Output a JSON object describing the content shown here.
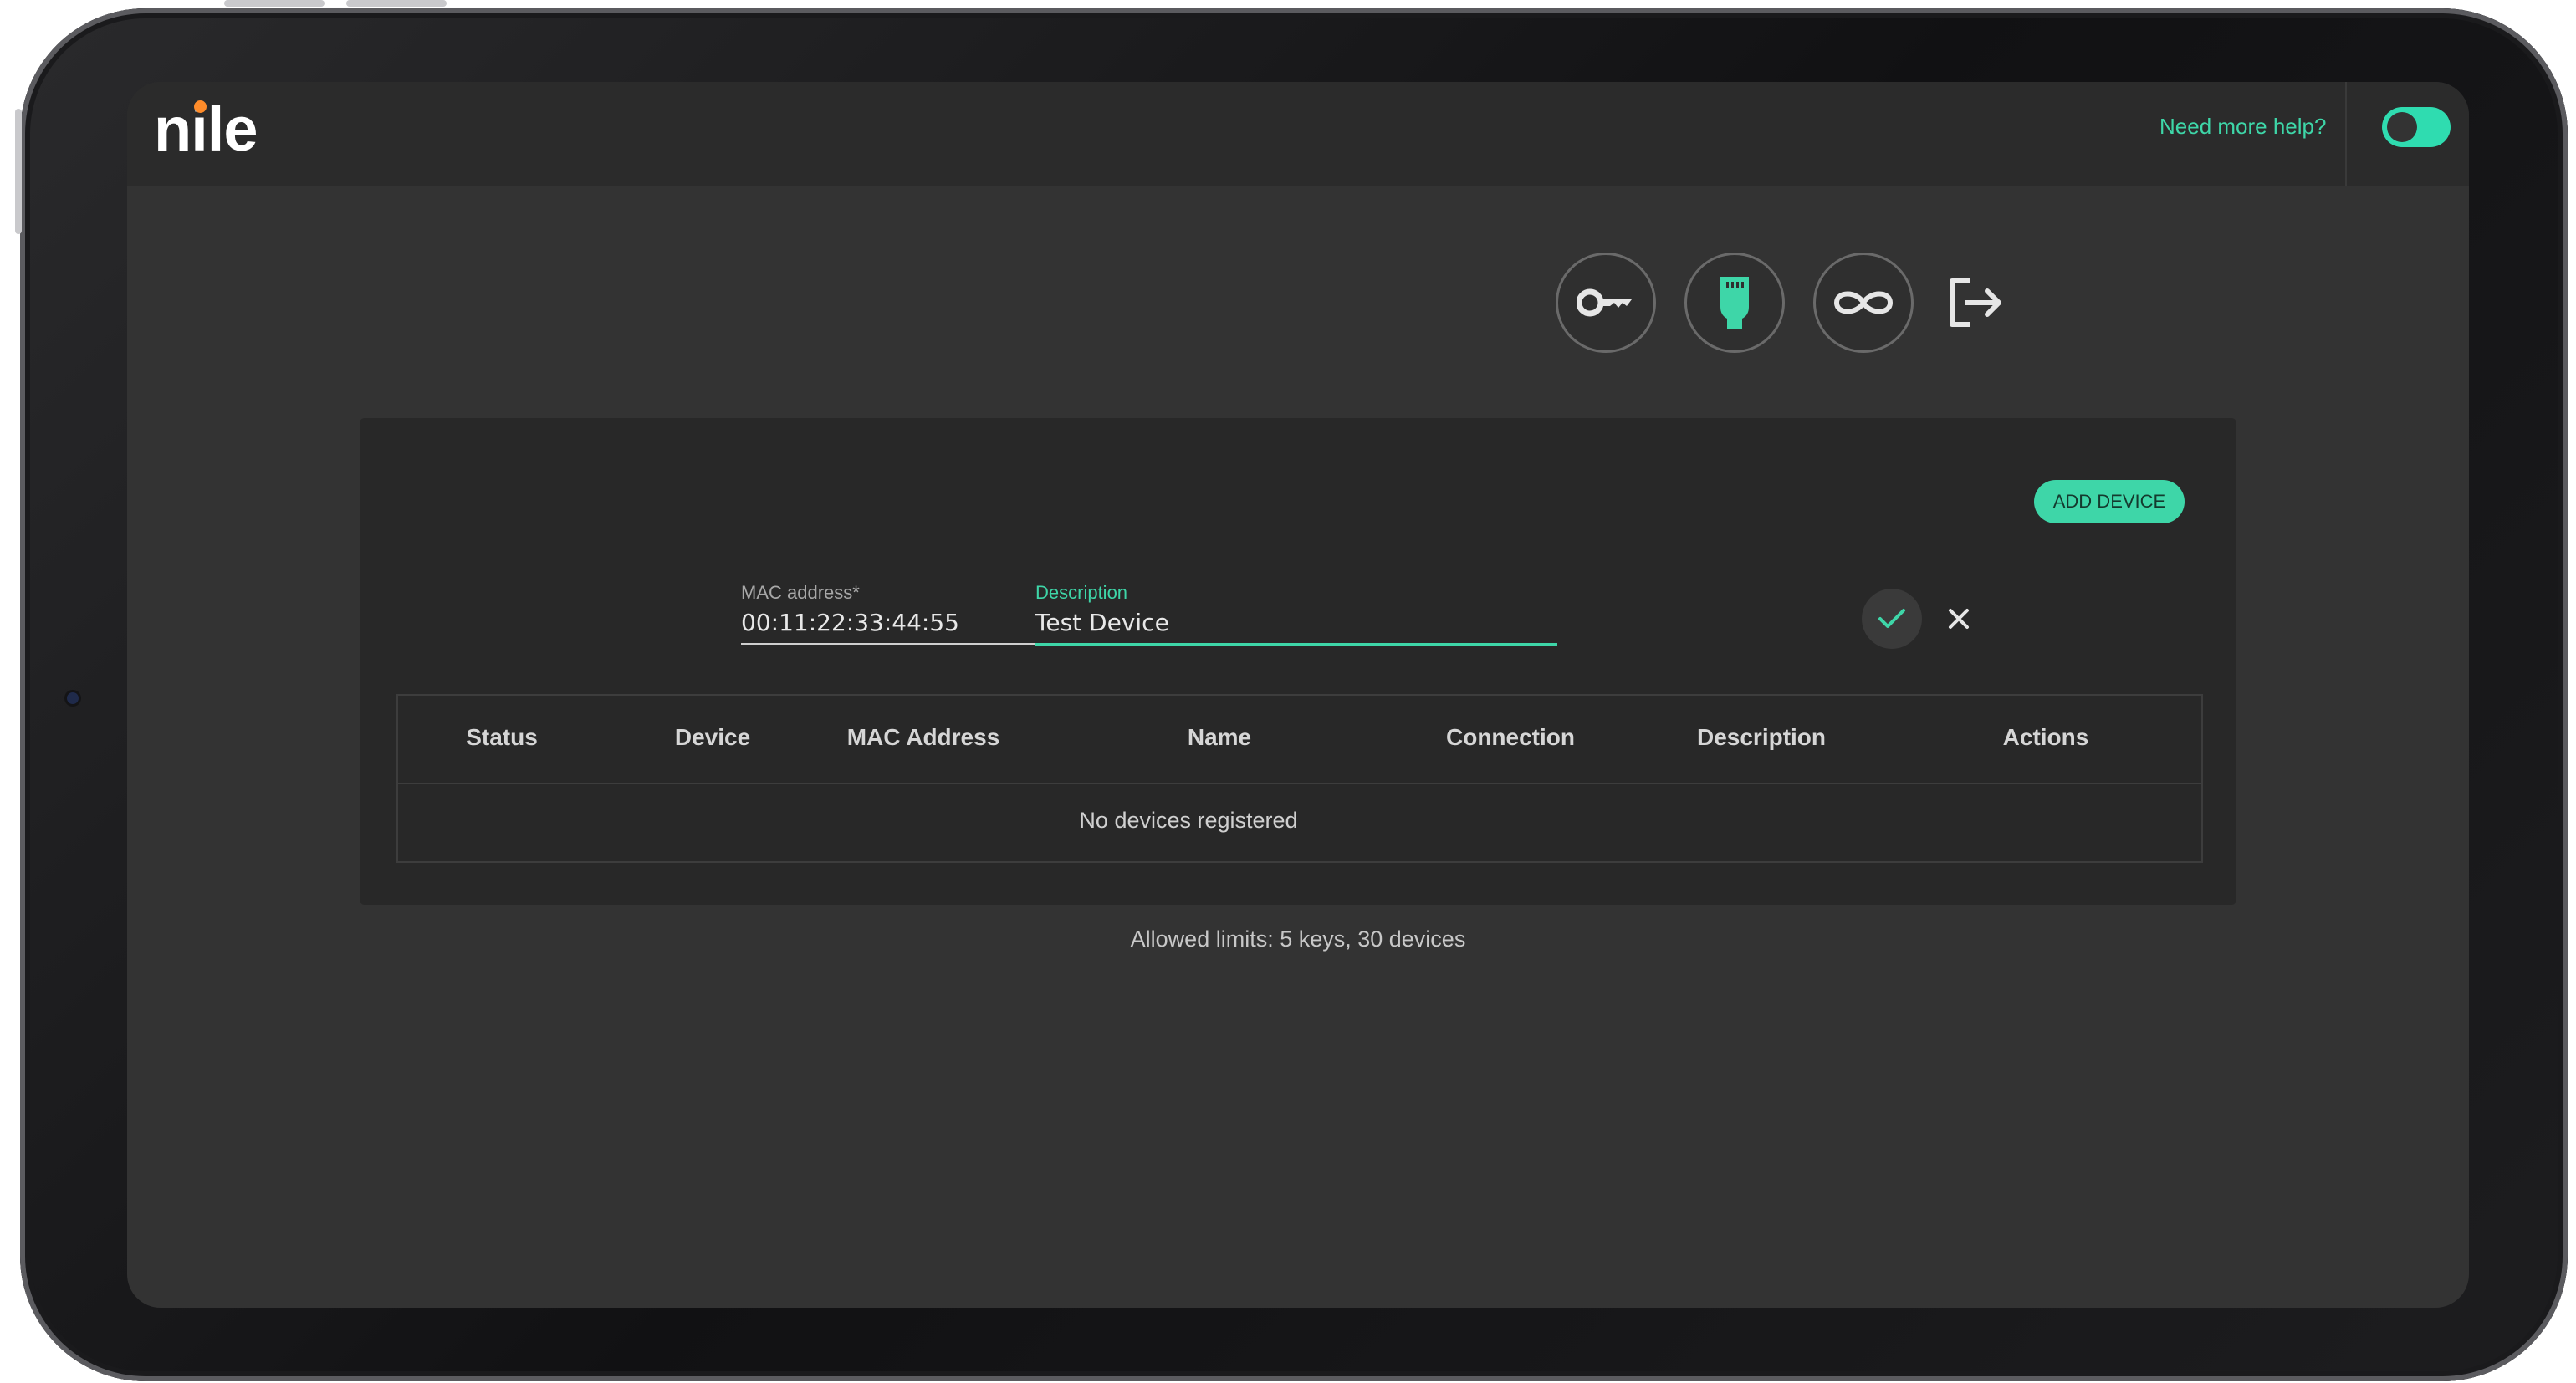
{
  "app": {
    "logo_text": "nile",
    "help_link": "Need more help?",
    "theme_toggle": {
      "state": "on"
    }
  },
  "toolbar": {
    "icons": [
      "key-icon",
      "ethernet-plug-icon",
      "infinity-link-icon",
      "logout-icon"
    ],
    "active": "ethernet-plug-icon"
  },
  "devices": {
    "add_button_label": "ADD DEVICE",
    "form": {
      "mac_label": "MAC address*",
      "mac_value": "00:11:22:33:44:55",
      "description_label": "Description",
      "description_value": "Test Device"
    },
    "table": {
      "columns": [
        "Status",
        "Device",
        "MAC Address",
        "Name",
        "Connection",
        "Description",
        "Actions"
      ],
      "rows": [],
      "empty_message": "No devices registered"
    },
    "limits_text": "Allowed limits: 5 keys, 30 devices"
  },
  "colors": {
    "accent": "#3ed6a8",
    "background": "#333333",
    "topbar": "#2b2b2b",
    "card": "#282828",
    "logo_dot": "#ff8c2a"
  }
}
